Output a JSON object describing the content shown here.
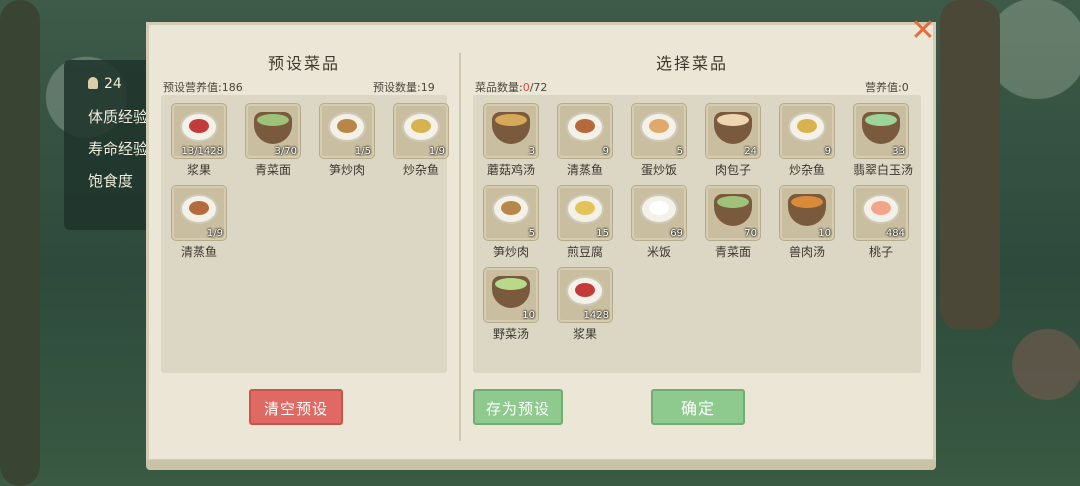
{
  "side_panel": {
    "level": "24",
    "rows": [
      "体质经验",
      "寿命经验",
      "饱食度"
    ]
  },
  "left_section": {
    "title": "预设菜品",
    "nutrition_label": "预设营养值:186",
    "count_label": "预设数量:19",
    "items": [
      {
        "name": "浆果",
        "count": "13/1428",
        "icon": "berry-dish"
      },
      {
        "name": "青菜面",
        "count": "3/70",
        "icon": "noodle-bowl"
      },
      {
        "name": "笋炒肉",
        "count": "1/5",
        "icon": "stirfry-dish"
      },
      {
        "name": "炒杂鱼",
        "count": "1/9",
        "icon": "fish-dish"
      },
      {
        "name": "清蒸鱼",
        "count": "1/9",
        "icon": "steamed-fish-dish"
      }
    ],
    "clear_button": "清空预设"
  },
  "right_section": {
    "title": "选择菜品",
    "dish_count_prefix": "菜品数量:",
    "dish_count_value": "0",
    "dish_count_total": "/72",
    "nutrition_label": "营养值:0",
    "items": [
      {
        "name": "蘑菇鸡汤",
        "count": "3",
        "icon": "chicken-soup"
      },
      {
        "name": "清蒸鱼",
        "count": "9",
        "icon": "steamed-fish-dish"
      },
      {
        "name": "蛋炒饭",
        "count": "5",
        "icon": "fried-rice"
      },
      {
        "name": "肉包子",
        "count": "24",
        "icon": "bun-basket"
      },
      {
        "name": "炒杂鱼",
        "count": "9",
        "icon": "fish-dish"
      },
      {
        "name": "翡翠白玉汤",
        "count": "33",
        "icon": "tofu-soup"
      },
      {
        "name": "笋炒肉",
        "count": "5",
        "icon": "stirfry-dish"
      },
      {
        "name": "煎豆腐",
        "count": "15",
        "icon": "fried-tofu"
      },
      {
        "name": "米饭",
        "count": "69",
        "icon": "rice"
      },
      {
        "name": "青菜面",
        "count": "70",
        "icon": "noodle-bowl"
      },
      {
        "name": "兽肉汤",
        "count": "10",
        "icon": "meat-soup"
      },
      {
        "name": "桃子",
        "count": "484",
        "icon": "peach"
      },
      {
        "name": "野菜汤",
        "count": "10",
        "icon": "veg-soup"
      },
      {
        "name": "浆果",
        "count": "1428",
        "icon": "berry-dish"
      }
    ],
    "save_button": "存为预设",
    "confirm_button": "确定"
  },
  "food_colors": {
    "berry-dish": "#c23a3a",
    "noodle-bowl": "#9ec27a",
    "stirfry-dish": "#b9864a",
    "fish-dish": "#d8b24c",
    "steamed-fish-dish": "#b46a3a",
    "chicken-soup": "#d7a85a",
    "fried-rice": "#e0a86a",
    "bun-basket": "#f0d6b0",
    "tofu-soup": "#9dd49a",
    "fried-tofu": "#e3c35a",
    "rice": "#ffffff",
    "meat-soup": "#d98a3a",
    "peach": "#f2a58a",
    "veg-soup": "#b8d98a"
  }
}
